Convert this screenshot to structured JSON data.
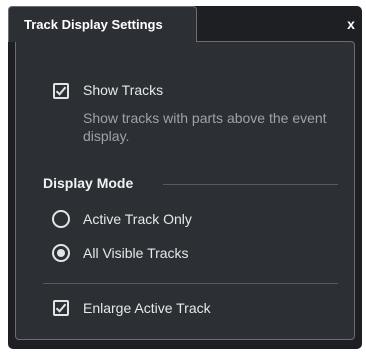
{
  "window": {
    "tab_title": "Track Display Settings",
    "close_label": "x"
  },
  "show_tracks": {
    "label": "Show Tracks",
    "checked": true,
    "description": "Show tracks with parts above the event display."
  },
  "display_mode": {
    "title": "Display Mode",
    "options": [
      {
        "label": "Active Track Only",
        "selected": false
      },
      {
        "label": "All Visible Tracks",
        "selected": true
      }
    ]
  },
  "enlarge_active_track": {
    "label": "Enlarge Active Track",
    "checked": true
  }
}
